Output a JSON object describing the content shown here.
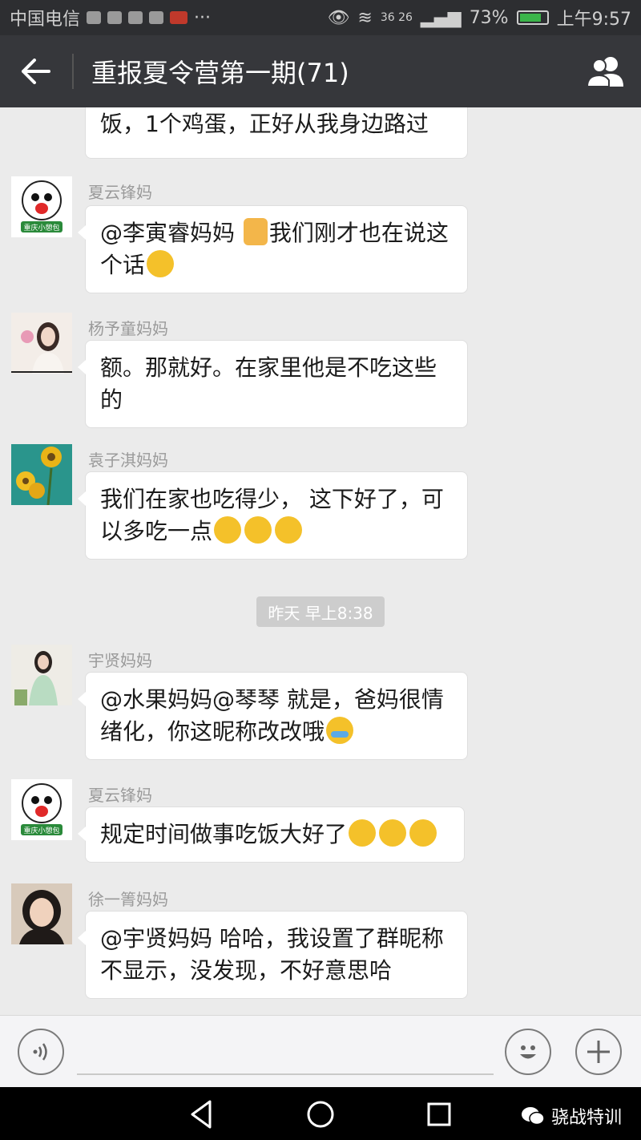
{
  "status_bar": {
    "carrier": "中国电信",
    "network": "36 26",
    "battery": "73%",
    "time": "上午9:57"
  },
  "header": {
    "title": "重报夏令营第一期(71)"
  },
  "messages": [
    {
      "name": "",
      "avatar": "avatar-partial",
      "text": "饭，1个鸡蛋，正好从我身边路过"
    },
    {
      "name": "夏云锋妈",
      "text_a": "@李寅睿妈妈 ",
      "text_b": "我们刚才也在说这个话"
    },
    {
      "name": "杨予童妈妈",
      "text": "额。那就好。在家里他是不吃这些的"
    },
    {
      "name": "袁子淇妈妈",
      "text_a": "我们在家也吃得少， 这下好了，可以多吃一点"
    },
    {
      "name": "宇贤妈妈",
      "text_a": "@水果妈妈@琴琴 就是，爸妈很情绪化，你这昵称改改哦"
    },
    {
      "name": "夏云锋妈",
      "text_a": "规定时间做事吃饭大好了"
    },
    {
      "name": "徐一箐妈妈",
      "text": "@宇贤妈妈 哈哈，我设置了群昵称不显示，没发现，不好意思哈"
    }
  ],
  "timestamp": "昨天 早上8:38",
  "avatar_badge": "重庆小憩包",
  "watermark": "骁战特训"
}
